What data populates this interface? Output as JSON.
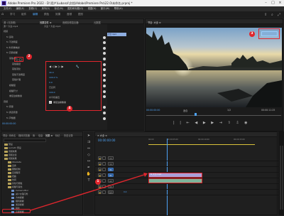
{
  "window": {
    "title": "Adobe Premiere Pro 2022 - D:\\用户\\Lubanzi\\文档\\Adobe\\Premiere Pro\\22.0\\未命名.prproj *"
  },
  "menubar": [
    "文件(F)",
    "编辑(E)",
    "剪辑(C)",
    "序列(S)",
    "标记(M)",
    "图形和标题(G)",
    "视图(V)",
    "窗口(W)",
    "帮助(H)"
  ],
  "workspace_tabs": [
    {
      "label": "学习",
      "active": false
    },
    {
      "label": "组件",
      "active": false
    },
    {
      "label": "编辑",
      "active": true
    },
    {
      "label": "颜色",
      "active": false
    },
    {
      "label": "效果",
      "active": false
    },
    {
      "label": "音频",
      "active": false
    },
    {
      "label": "图形",
      "active": false
    }
  ],
  "effect_panel": {
    "tabs": [
      "源: (无剪辑)",
      "效果控件 ≡",
      "音频剪辑混合器:",
      "元数据"
    ],
    "source_label": "源 * 大全.mp4",
    "sequence_label": "大全 * 大全.mp4",
    "mini_clip_label": "大全.mp4",
    "rows": [
      {
        "label": "视频",
        "indent": 0
      },
      {
        "label": "fx 运动",
        "indent": 1
      },
      {
        "label": "fx 不透明度",
        "indent": 1
      },
      {
        "label": "fx 时间重映射",
        "indent": 1
      },
      {
        "label": "fx 高斯模糊",
        "indent": 1
      },
      {
        "label": "蒙版(1)",
        "indent": 2
      },
      {
        "label": "蒙版路径",
        "indent": 3
      },
      {
        "label": "蒙版羽化",
        "indent": 3
      },
      {
        "label": "蒙版不透明度",
        "indent": 3
      },
      {
        "label": "蒙版扩展",
        "indent": 3
      },
      {
        "label": "模糊度",
        "indent": 2
      },
      {
        "label": "模糊尺寸",
        "indent": 2
      },
      {
        "label": "重复边缘像素",
        "indent": 2
      },
      {
        "label": "音频",
        "indent": 0
      },
      {
        "label": "fx 音量",
        "indent": 1
      },
      {
        "label": "fx 通道音量",
        "indent": 1
      },
      {
        "label": "fx 声像器",
        "indent": 1
      }
    ],
    "mask_values": [
      "40.0",
      "100.0 %",
      "0.0",
      "100.0"
    ],
    "mask_options": [
      "已反转",
      "水平和垂直"
    ],
    "mask_checkbox_label": "重复边缘像素",
    "timecode": "00:00:00:00"
  },
  "program_monitor": {
    "title": "节目: 大全 ≡",
    "timecode_left": "00:00:00:00",
    "fit": "适合",
    "ratio": "1/2",
    "timecode_right": "00:00:11:25"
  },
  "project_panel": {
    "tabs": [
      "项目: 未命名",
      "媒体浏览器",
      "库",
      "信息",
      "效果 ≡",
      "标记",
      "历史记录"
    ],
    "items": [
      {
        "label": "预设",
        "depth": 0
      },
      {
        "label": "Lumetri 预设",
        "depth": 0
      },
      {
        "label": "音频效果",
        "depth": 0
      },
      {
        "label": "音频过渡",
        "depth": 0
      },
      {
        "label": "视频效果",
        "depth": 0
      },
      {
        "label": "Obsolete",
        "depth": 1
      },
      {
        "label": "变换",
        "depth": 1
      },
      {
        "label": "图像控制",
        "depth": 1
      },
      {
        "label": "实用程序",
        "depth": 1
      },
      {
        "label": "扭曲",
        "depth": 1
      },
      {
        "label": "时间",
        "depth": 1
      },
      {
        "label": "杂色与颗粒",
        "depth": 1
      },
      {
        "label": "模糊与锐化",
        "depth": 1
      },
      {
        "label": "Camera Blur",
        "depth": 2
      },
      {
        "label": "减少交错闪烁",
        "depth": 2
      },
      {
        "label": "方向模糊",
        "depth": 2
      },
      {
        "label": "相机模糊",
        "depth": 2
      },
      {
        "label": "通道模糊",
        "depth": 2
      },
      {
        "label": "锐化",
        "depth": 2
      },
      {
        "label": "高斯模糊",
        "depth": 2
      }
    ]
  },
  "timeline": {
    "title": "× 大全 ≡",
    "timecode": "00:00:00:00",
    "ruler_marks": [
      "00:00",
      "00:00:05:00",
      "00:00:10:00",
      "00:00:15:00"
    ],
    "tracks": [
      "V3",
      "V2",
      "V1",
      "A1",
      "A2",
      "A3",
      "混合"
    ],
    "clip_v1": "fx 大全.mp4",
    "mix_value": "0.0"
  },
  "badges": [
    "1",
    "2",
    "3",
    "4"
  ]
}
